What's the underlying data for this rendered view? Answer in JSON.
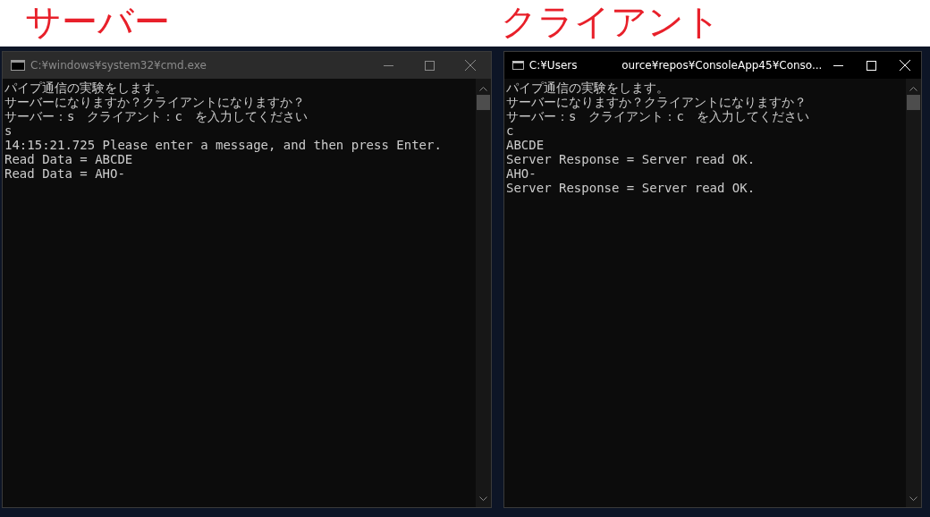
{
  "annotations": [
    {
      "text": "サーバー"
    },
    {
      "text": "クライアント"
    }
  ],
  "windows": [
    {
      "title_parts": [
        "C:¥windows¥system32¥cmd.exe"
      ],
      "active": false,
      "lines": [
        "パイプ通信の実験をします。",
        "サーバーになりますか？クライアントになりますか？",
        "サーバー：s　クライアント：c　を入力してください",
        "s",
        "14:15:21.725 Please enter a message, and then press Enter.",
        "Read Data = ABCDE",
        "Read Data = AHO-"
      ]
    },
    {
      "title_parts": [
        "C:¥Users",
        "ource¥repos¥ConsoleApp45¥Conso..."
      ],
      "active": true,
      "lines": [
        "パイプ通信の実験をします。",
        "サーバーになりますか？クライアントになりますか？",
        "サーバー：s　クライアント：c　を入力してください",
        "c",
        "ABCDE",
        "Server Response = Server read OK.",
        "AHO-",
        "Server Response = Server read OK."
      ]
    }
  ]
}
